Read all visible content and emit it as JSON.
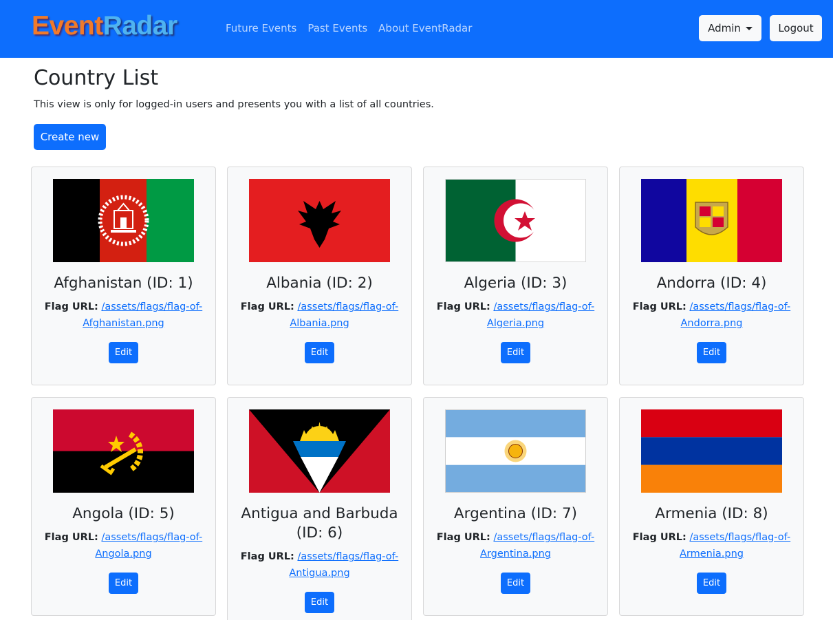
{
  "nav": {
    "brand_part1": "Event",
    "brand_part2": "Radar",
    "links": [
      "Future Events",
      "Past Events",
      "About EventRadar"
    ],
    "admin_label": "Admin",
    "logout_label": "Logout"
  },
  "page": {
    "title": "Country List",
    "description": "This view is only for logged-in users and presents you with a list of all countries.",
    "create_label": "Create new"
  },
  "cards": [
    {
      "title": "Afghanistan (ID: 1)",
      "flag_label": "Flag URL:",
      "url1": "/assets/flags/flag-of-",
      "url2": "Afghanistan.png",
      "edit_label": "Edit"
    },
    {
      "title": "Albania (ID: 2)",
      "flag_label": "Flag URL:",
      "url1": "/assets/flags/flag-of-",
      "url2": "Albania.png",
      "edit_label": "Edit"
    },
    {
      "title": "Algeria (ID: 3)",
      "flag_label": "Flag URL:",
      "url1": "/assets/flags/flag-of-",
      "url2": "Algeria.png",
      "edit_label": "Edit"
    },
    {
      "title": "Andorra (ID: 4)",
      "flag_label": "Flag URL:",
      "url1": "/assets/flags/flag-of-",
      "url2": "Andorra.png",
      "edit_label": "Edit"
    },
    {
      "title": "Angola (ID: 5)",
      "flag_label": "Flag URL:",
      "url1": "/assets/flags/flag-of-",
      "url2": "Angola.png",
      "edit_label": "Edit"
    },
    {
      "title_line1": "Antigua and Barbuda",
      "title_line2": "(ID: 6)",
      "flag_label": "Flag URL:",
      "url1": "/assets/flags/flag-of-",
      "url2": "Antigua.png",
      "edit_label": "Edit"
    },
    {
      "title": "Argentina (ID: 7)",
      "flag_label": "Flag URL:",
      "url1": "/assets/flags/flag-of-",
      "url2": "Argentina.png",
      "edit_label": "Edit"
    },
    {
      "title": "Armenia (ID: 8)",
      "flag_label": "Flag URL:",
      "url1": "/assets/flags/flag-of-",
      "url2": "Armenia.png",
      "edit_label": "Edit"
    }
  ],
  "colors": {
    "primary": "#0d6efd",
    "card_bg": "#f8f9fa"
  }
}
